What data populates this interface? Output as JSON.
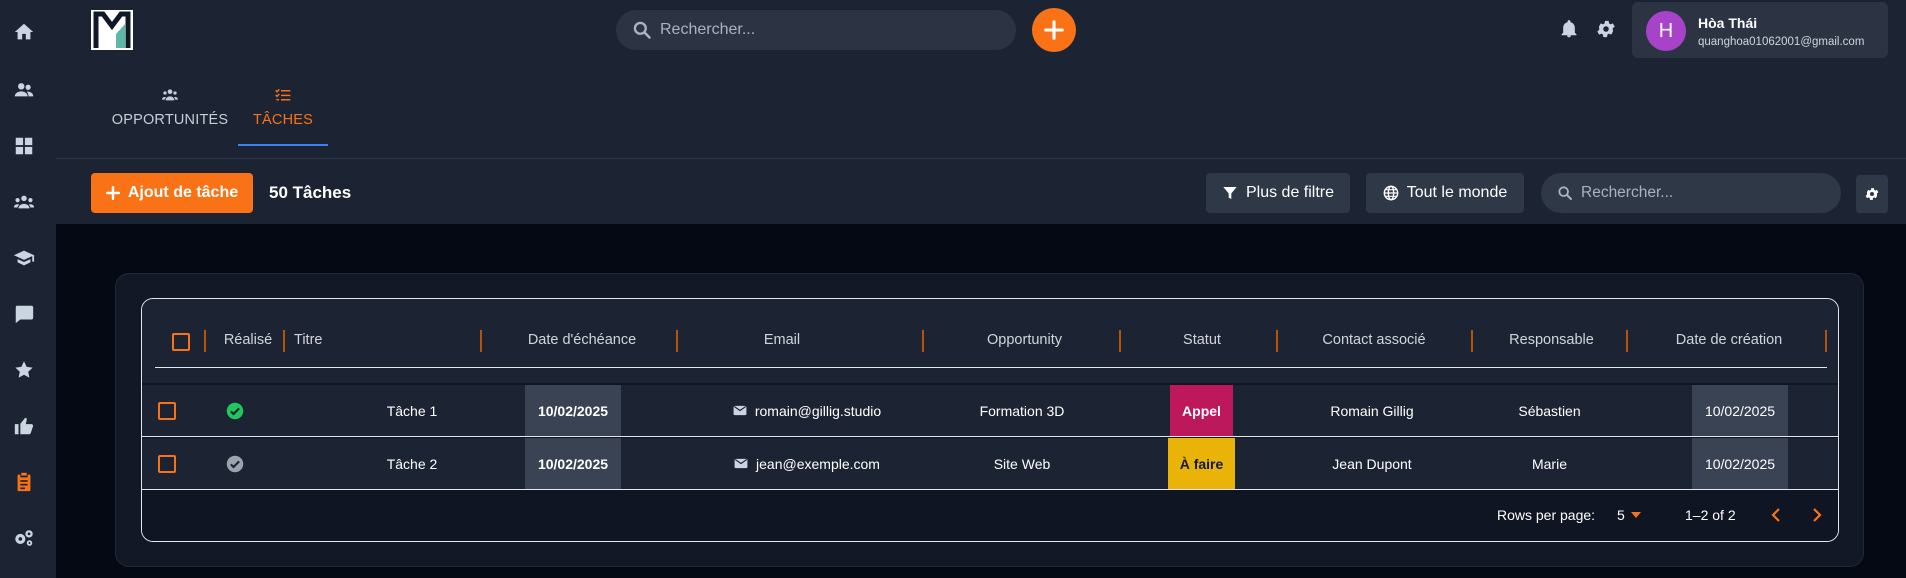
{
  "header": {
    "search_placeholder": "Rechercher...",
    "user": {
      "initial": "H",
      "name": "Hòa Thái",
      "email": "quanghoa01062001@gmail.com",
      "avatar_color": "#a643c9"
    }
  },
  "sidebar": {
    "icons": [
      "home-icon",
      "contacts-icon",
      "dashboard-icon",
      "groups-icon",
      "school-icon",
      "chat-icon",
      "star-icon",
      "thumb-up-icon",
      "clipboard-icon",
      "settings-group-icon"
    ],
    "active": "clipboard-icon"
  },
  "tabs": [
    {
      "label": "OPPORTUNITÉS",
      "icon": "people-icon",
      "active": false
    },
    {
      "label": "TÂCHES",
      "icon": "task-list-icon",
      "active": true
    }
  ],
  "toolbar": {
    "add_label": "Ajout de tâche",
    "count_label": "50 Tâches",
    "filter_label": "Plus de filtre",
    "everyone_label": "Tout le monde",
    "search_placeholder": "Rechercher..."
  },
  "table": {
    "columns": [
      "Réalisé",
      "Titre",
      "Date d'échéance",
      "Email",
      "Opportunity",
      "Statut",
      "Contact associé",
      "Responsable",
      "Date de création"
    ],
    "rows": [
      {
        "done": true,
        "title": "Tâche 1",
        "due": "10/02/2025",
        "email": "romain@gillig.studio",
        "opportunity": "Formation 3D",
        "status": "Appel",
        "status_color": "#be185d",
        "contact": "Romain Gillig",
        "owner": "Sébastien",
        "created": "10/02/2025"
      },
      {
        "done": false,
        "title": "Tâche 2",
        "due": "10/02/2025",
        "email": "jean@exemple.com",
        "opportunity": "Site Web",
        "status": "À faire",
        "status_color": "#eab308",
        "contact": "Jean Dupont",
        "owner": "Marie",
        "created": "10/02/2025"
      }
    ],
    "footer": {
      "rows_per_page_label": "Rows per page:",
      "rows_per_page": "5",
      "range": "1–2 of 2"
    }
  },
  "colors": {
    "accent": "#f97316",
    "tab_underline": "#3b82f6",
    "done": "#22c55e",
    "not_done": "#9ca3af"
  }
}
